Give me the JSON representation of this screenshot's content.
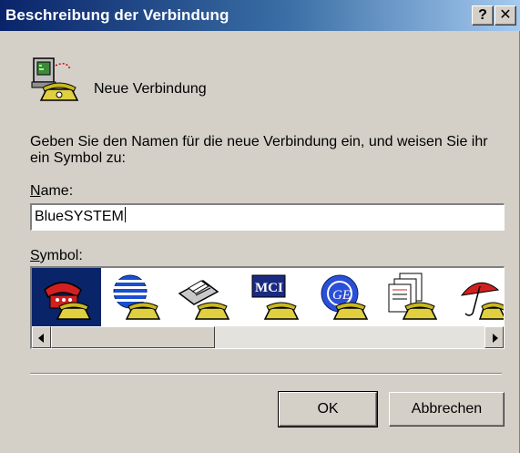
{
  "window": {
    "title": "Beschreibung der Verbindung",
    "help_label": "?",
    "close_label": "✕"
  },
  "connection": {
    "name": "Neue Verbindung",
    "icon": "modem-phone-icon"
  },
  "description": "Geben Sie den Namen für die neue Verbindung ein, und weisen Sie ihr ein Symbol zu:",
  "name_field": {
    "label_accel": "N",
    "label_rest": "ame:",
    "value": "BlueSYSTEM"
  },
  "symbol_field": {
    "label_accel": "S",
    "label_rest": "ymbol:",
    "icons": [
      "red-phone-icon",
      "striped-globe-phone-icon",
      "fax-phone-icon",
      "mci-phone-icon",
      "ge-phone-icon",
      "documents-phone-icon",
      "umbrella-phone-icon"
    ],
    "selected_index": 0
  },
  "buttons": {
    "ok": "OK",
    "cancel": "Abbrechen"
  },
  "colors": {
    "title_start": "#0a246a",
    "title_end": "#a6caf0",
    "face": "#d4d0c8",
    "selection": "#0a246a"
  }
}
